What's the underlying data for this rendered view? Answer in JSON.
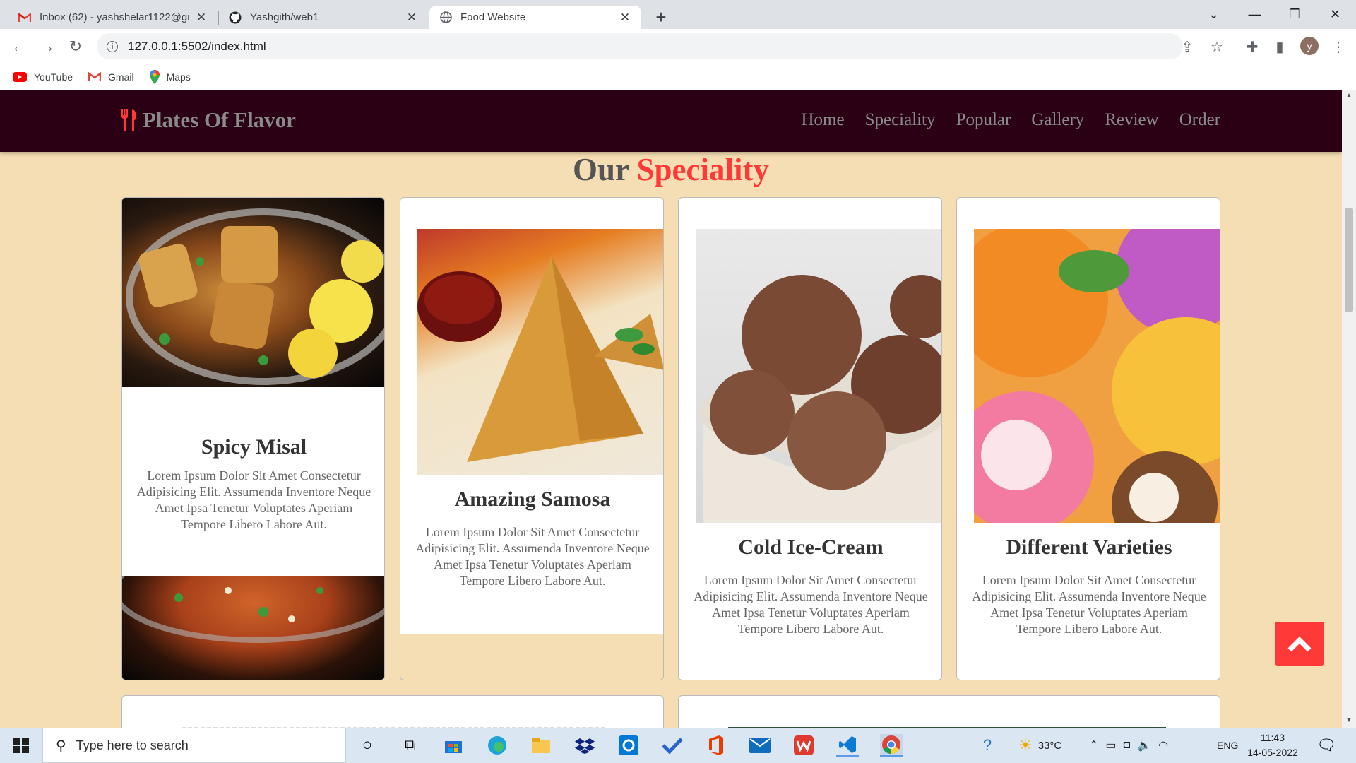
{
  "browser": {
    "tabs": [
      {
        "title": "Inbox (62) - yashshelar1122@gm",
        "icon": "gmail-icon",
        "active": false
      },
      {
        "title": "Yashgith/web1",
        "icon": "github-icon",
        "active": false
      },
      {
        "title": "Food Website",
        "icon": "globe-icon",
        "active": true
      }
    ],
    "new_tab": "+",
    "url": "127.0.0.1:5502/index.html",
    "profile_initial": "y",
    "bookmarks": [
      {
        "label": "YouTube",
        "icon": "youtube-icon"
      },
      {
        "label": "Gmail",
        "icon": "gmail-icon"
      },
      {
        "label": "Maps",
        "icon": "maps-icon"
      }
    ]
  },
  "site": {
    "logo": "Plates Of Flavor",
    "nav": [
      "Home",
      "Speciality",
      "Popular",
      "Gallery",
      "Review",
      "Order"
    ],
    "section_title_1": "Our",
    "section_title_2": "Speciality",
    "cards": [
      {
        "title": "Spicy Misal",
        "desc": "Lorem Ipsum Dolor Sit Amet Consectetur Adipisicing Elit. Assumenda Inventore Neque Amet Ipsa Tenetur Voluptates Aperiam Tempore Libero Labore Aut."
      },
      {
        "title": "Amazing Samosa",
        "desc": "Lorem Ipsum Dolor Sit Amet Consectetur Adipisicing Elit. Assumenda Inventore Neque Amet Ipsa Tenetur Voluptates Aperiam Tempore Libero Labore Aut."
      },
      {
        "title": "Cold Ice-Cream",
        "desc": "Lorem Ipsum Dolor Sit Amet Consectetur Adipisicing Elit. Assumenda Inventore Neque Amet Ipsa Tenetur Voluptates Aperiam Tempore Libero Labore Aut."
      },
      {
        "title": "Different Varieties",
        "desc": "Lorem Ipsum Dolor Sit Amet Consectetur Adipisicing Elit. Assumenda Inventore Neque Amet Ipsa Tenetur Voluptates Aperiam Tempore Libero Labore Aut."
      }
    ],
    "colors": {
      "header": "#2b0014",
      "accent": "#ff3838",
      "background": "#f5deb3"
    }
  },
  "taskbar": {
    "search_placeholder": "Type here to search",
    "temperature": "33°C",
    "language": "ENG",
    "time": "11:43",
    "date": "14-05-2022"
  }
}
